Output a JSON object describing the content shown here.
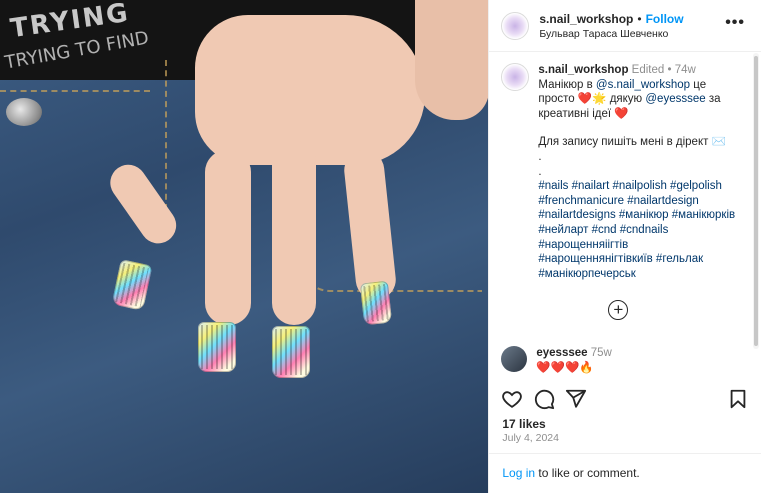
{
  "post": {
    "username": "s.nail_workshop",
    "separator": "•",
    "follow_label": "Follow",
    "location": "Бульвар Тараса Шевченко",
    "more_label": "•••"
  },
  "caption": {
    "username": "s.nail_workshop",
    "edited": "Edited",
    "separator": "•",
    "age": "74w",
    "line1_text": "Манікюр в ",
    "mention1": "@s.nail_workshop",
    "line1_tail": " це просто ",
    "emojis1": "❤️🌟",
    "line1_mid": " дякую ",
    "mention2": "@eyesssee",
    "line1_end": " за креативні ідеї ",
    "emoji2": "❤️",
    "line2": "Для запису пишіть мені в дірект ✉️",
    "dot1": ".",
    "dot2": ".",
    "hashtags": "#nails #nailart #nailpolish #gelpolish #frenchmanicure #nailartdesign #nailartdesigns #манікюр #манікюрків #нейларт #cnd #cndnails #нарощенняіігтів #нарощеннянігтівкиїв #гельлак #манікюрпечерськ"
  },
  "load_more_label": "+",
  "comment": {
    "username": "eyesssee",
    "age": "75w",
    "text": "❤️❤️❤️🔥"
  },
  "likes": "17 likes",
  "date": "July 4, 2024",
  "footer": {
    "login": "Log in",
    "rest": " to like or comment."
  },
  "photo": {
    "shirt_text1": "TRYING",
    "shirt_text2": "TRYING TO FIND"
  },
  "colors": {
    "link": "#00376b",
    "follow": "#0095f6",
    "meta": "#8e8e8e"
  },
  "icons": [
    "heart-icon",
    "comment-icon",
    "share-icon",
    "bookmark-icon",
    "more-icon",
    "add-circle-icon"
  ]
}
